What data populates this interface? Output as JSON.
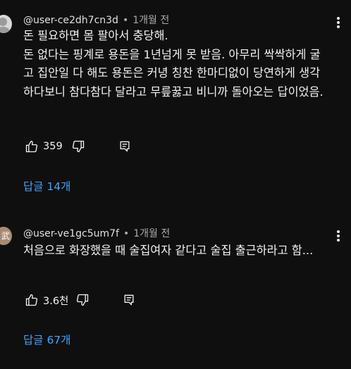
{
  "comments": [
    {
      "handle": "@user-ce2dh7cn3d",
      "time": "1개월 전",
      "text": "돈 필요하면 몸 팔아서 충당해.\n돈 없다는 핑계로 용돈을 1년넘게 못 받음. 아무리 싹싹하게 굴고 집안일 다 해도 용돈은 커녕 칭찬 한마디없이 당연하게 생각하다보니 참다참다 달라고 무릎꿇고 비니까 돌아오는 답이었음.",
      "likes": "359",
      "replies_label": "답글 14개",
      "avatar_icon": "default-person-avatar"
    },
    {
      "handle": "@user-ve1gc5um7f",
      "time": "1개월 전",
      "text": "처음으로 화장했을 때 술집여자 같다고 술집 출근하라고 함...",
      "likes": "3.6천",
      "replies_label": "답글 67개",
      "avatar_icon": "avatar-image",
      "avatar_text": "武"
    }
  ],
  "colors": {
    "background": "#0f0f0f",
    "text": "#f1f1f1",
    "muted": "#aaaaaa",
    "link": "#3ea6ff"
  }
}
